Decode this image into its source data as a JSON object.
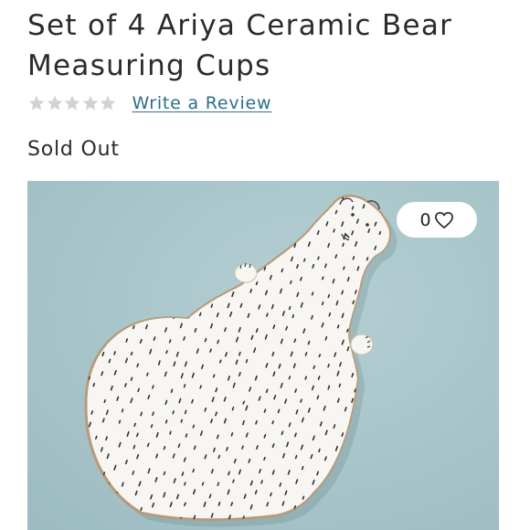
{
  "product": {
    "title": "Set of 4 Ariya Ceramic Bear Measuring Cups",
    "rating_stars": 5,
    "rating_filled": 0,
    "write_review_label": "Write a Review",
    "availability": "Sold Out"
  },
  "favorite": {
    "count": "0",
    "icon": "heart-outline-icon"
  },
  "icons": {
    "star": "star-icon",
    "heart": "heart-icon"
  },
  "colors": {
    "text": "#2b2b2b",
    "link": "#2c6e8c",
    "star_empty": "#d2d2d2",
    "image_background": "#a6c4c9",
    "plate": "#f7f6f2"
  }
}
